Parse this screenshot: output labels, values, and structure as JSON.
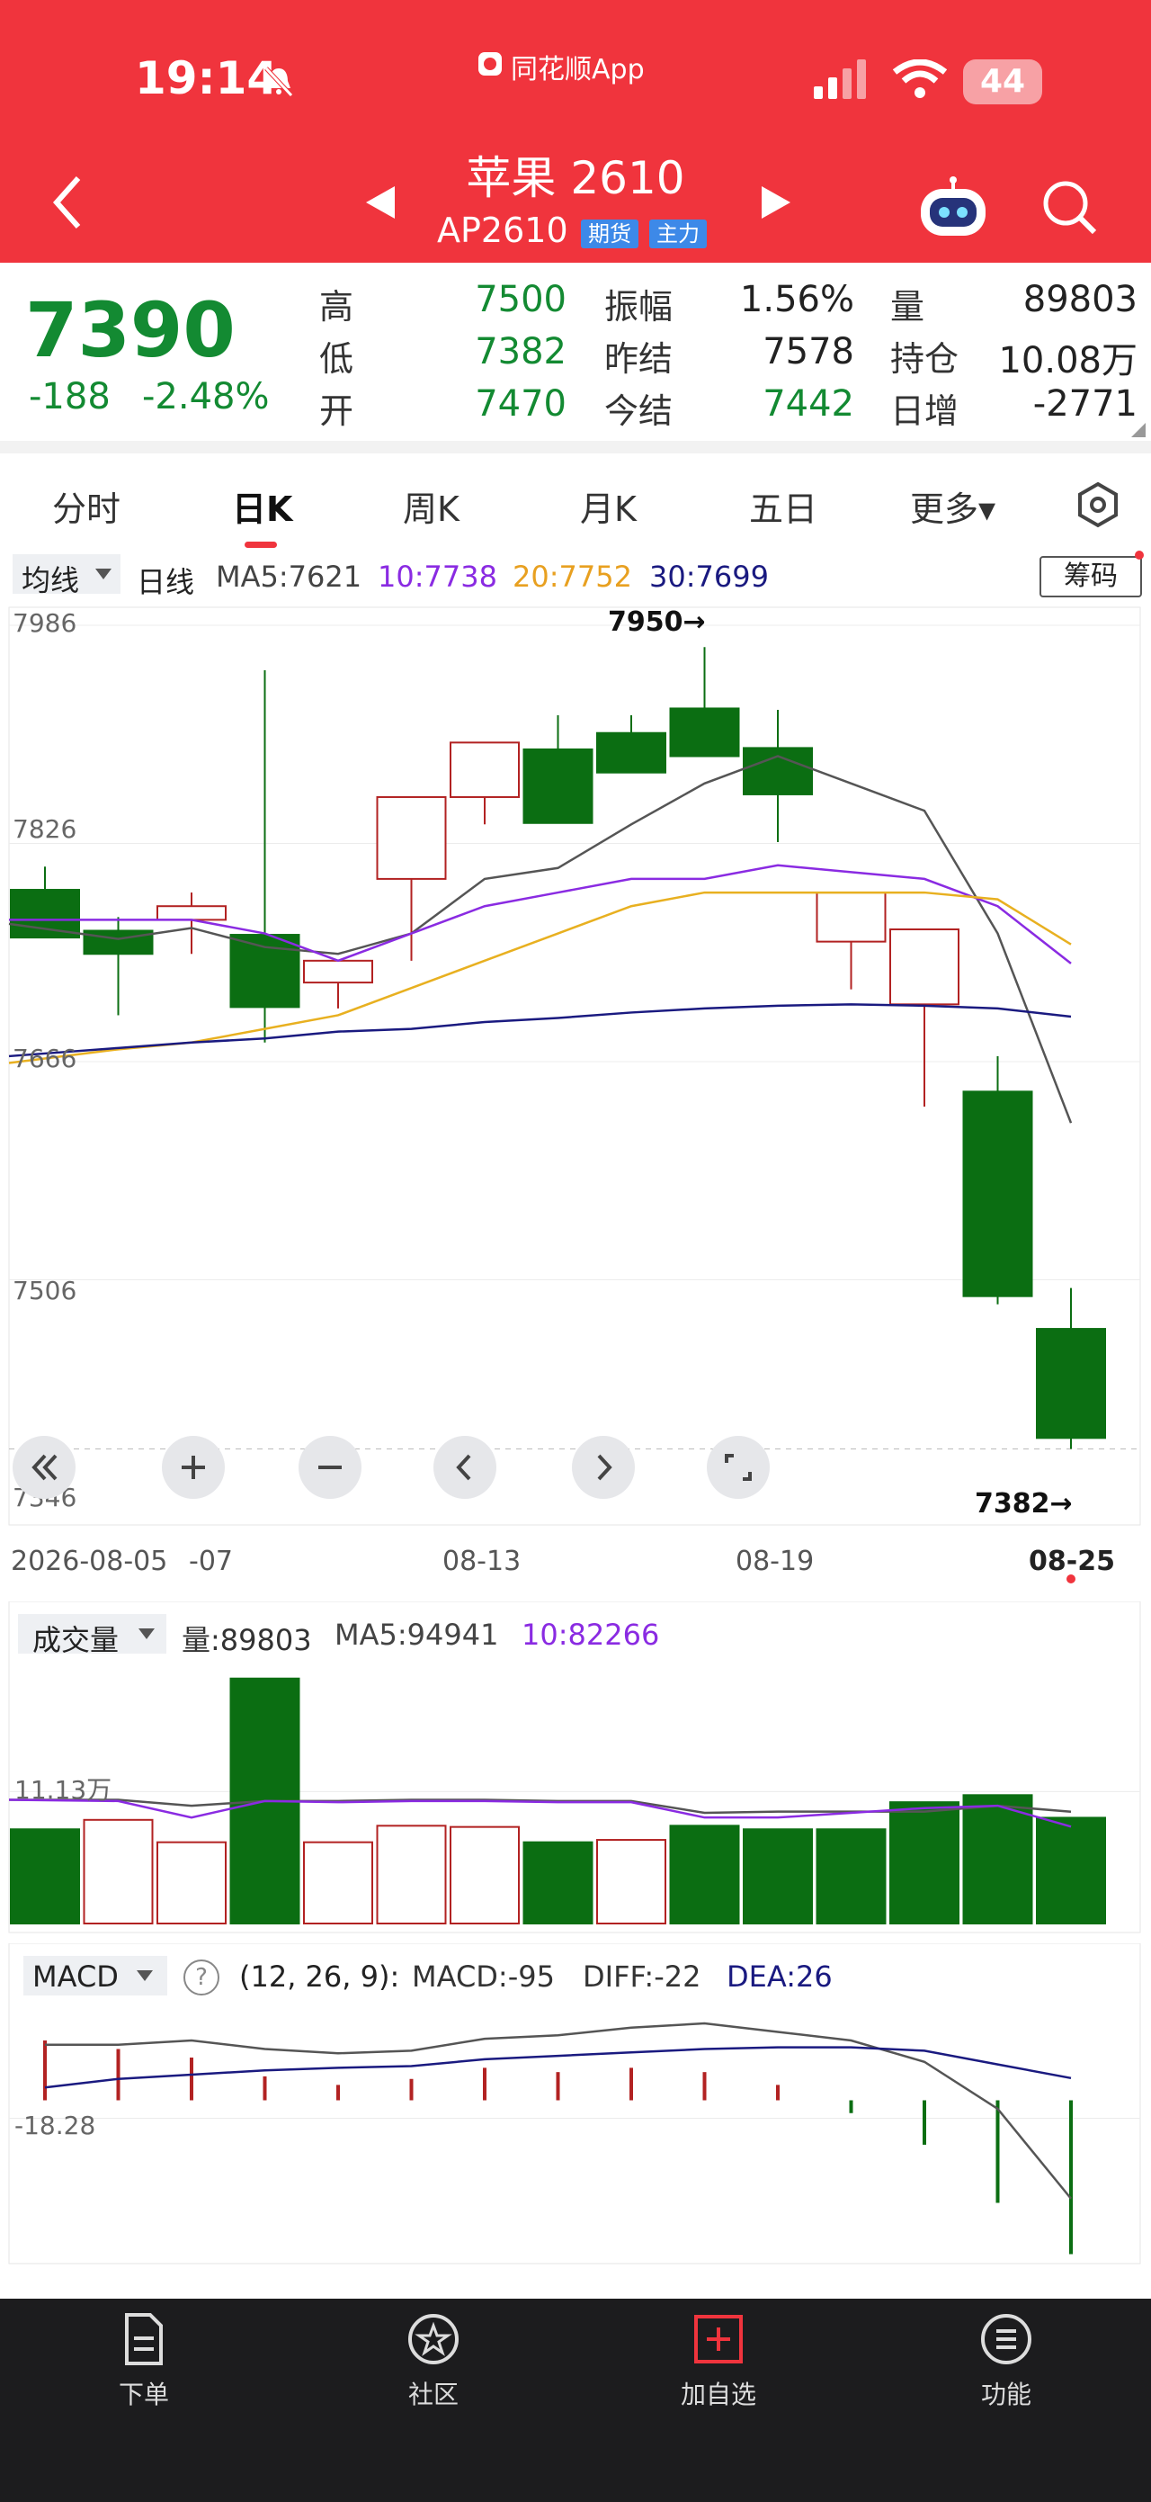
{
  "status_bar": {
    "time": "19:14",
    "app_label": "同花顺App",
    "battery": "44"
  },
  "header": {
    "title": "苹果 2610",
    "code": "AP2610",
    "tags": [
      "期货",
      "主力"
    ]
  },
  "quote": {
    "price": "7390",
    "change": "-188",
    "change_pct": "-2.48%",
    "fields": [
      {
        "label": "高",
        "value": "7500"
      },
      {
        "label": "低",
        "value": "7382"
      },
      {
        "label": "开",
        "value": "7470"
      },
      {
        "label": "振幅",
        "value": "1.56%"
      },
      {
        "label": "昨结",
        "value": "7578"
      },
      {
        "label": "今结",
        "value": "7442"
      },
      {
        "label": "量",
        "value": "89803"
      },
      {
        "label": "持仓",
        "value": "10.08万"
      },
      {
        "label": "日增",
        "value": "-2771"
      }
    ]
  },
  "tabs": [
    "分时",
    "日K",
    "周K",
    "月K",
    "五日",
    "更多▾"
  ],
  "ma_bar": {
    "selector": "均线",
    "period": "日线",
    "ma5": "MA5:7621",
    "ma10": "10:7738",
    "ma20": "20:7752",
    "ma30": "30:7699",
    "chip_button": "筹码"
  },
  "price_axis": [
    "7986",
    "7826",
    "7666",
    "7506",
    "7346"
  ],
  "annotations": {
    "high_mark": "7950→",
    "low_mark": "7382→"
  },
  "dates": [
    "2026-08-05",
    "-07",
    "08-13",
    "08-19",
    "08-25"
  ],
  "volume_bar": {
    "selector": "成交量",
    "vol": "量:89803",
    "ma5": "MA5:94941",
    "ma10": "10:82266",
    "axis": "11.13万"
  },
  "macd_bar": {
    "selector": "MACD",
    "help": "?",
    "params": "(12, 26, 9):",
    "macd": "MACD:-95",
    "diff": "DIFF:-22",
    "dea": "DEA:26",
    "axis": "-18.28"
  },
  "bottom_nav": [
    "下单",
    "社区",
    "加自选",
    "功能"
  ],
  "colors": {
    "header": "#f0343d",
    "up": "#b22222",
    "down": "#0b6e12",
    "ma5": "#555555",
    "ma10": "#8a2be2",
    "ma20": "#e8b020",
    "ma30": "#1a1a80"
  },
  "chart_data": [
    {
      "type": "candlestick",
      "title": "苹果 2610 日K",
      "x": [
        "2026-08-05",
        "08-06",
        "08-07",
        "08-08",
        "08-11",
        "08-12",
        "08-13",
        "08-14",
        "08-15",
        "08-18",
        "08-19",
        "08-20",
        "08-21",
        "08-22",
        "08-25"
      ],
      "ohlc": [
        [
          7792,
          7809,
          7760,
          7757
        ],
        [
          7762,
          7772,
          7700,
          7745
        ],
        [
          7770,
          7790,
          7745,
          7780
        ],
        [
          7759,
          7953,
          7680,
          7706
        ],
        [
          7724,
          7740,
          7705,
          7740
        ],
        [
          7800,
          7825,
          7740,
          7860
        ],
        [
          7860,
          7890,
          7840,
          7900
        ],
        [
          7895,
          7920,
          7845,
          7841
        ],
        [
          7907,
          7920,
          7888,
          7878
        ],
        [
          7925,
          7970,
          7896,
          7890
        ],
        [
          7896,
          7924,
          7827,
          7862
        ],
        [
          7754,
          7785,
          7719,
          7790
        ],
        [
          7708,
          7730,
          7633,
          7763
        ],
        [
          7644,
          7670,
          7488,
          7494
        ],
        [
          7470,
          7500,
          7382,
          7390
        ]
      ],
      "ylim": [
        7346,
        7986
      ],
      "ma5": [
        7767,
        7756,
        7764,
        7750,
        7745,
        7760,
        7800,
        7808,
        7840,
        7870,
        7890,
        7870,
        7850,
        7760,
        7621
      ],
      "ma10": [
        7770,
        7770,
        7770,
        7760,
        7740,
        7760,
        7780,
        7790,
        7800,
        7800,
        7810,
        7805,
        7800,
        7780,
        7738
      ],
      "ma20": [
        7665,
        7675,
        7680,
        7690,
        7700,
        7720,
        7740,
        7760,
        7780,
        7790,
        7790,
        7790,
        7790,
        7785,
        7752
      ],
      "ma30": [
        7670,
        7676,
        7680,
        7683,
        7688,
        7690,
        7695,
        7698,
        7702,
        7705,
        7707,
        7708,
        7707,
        7705,
        7699
      ]
    },
    {
      "type": "bar",
      "title": "成交量",
      "categories": [
        "2026-08-05",
        "08-06",
        "08-07",
        "08-08",
        "08-11",
        "08-12",
        "08-13",
        "08-14",
        "08-15",
        "08-18",
        "08-19",
        "08-20",
        "08-21",
        "08-22",
        "08-25"
      ],
      "values": [
        80000,
        88000,
        69000,
        208000,
        69000,
        83000,
        82000,
        69000,
        71000,
        83000,
        80000,
        80000,
        103000,
        109000,
        89803
      ],
      "up": [
        false,
        true,
        true,
        false,
        true,
        true,
        true,
        false,
        true,
        false,
        false,
        false,
        false,
        false,
        false
      ],
      "ma5": [
        105000,
        105000,
        100000,
        104000,
        104000,
        105000,
        105000,
        104000,
        104000,
        94000,
        95000,
        95000,
        95000,
        100000,
        94941
      ],
      "ma10": [
        105000,
        104000,
        90000,
        104000,
        103000,
        104000,
        104000,
        103000,
        103000,
        90000,
        90000,
        94000,
        98000,
        100000,
        82266
      ],
      "ylim": [
        0,
        220000
      ]
    },
    {
      "type": "bar",
      "title": "MACD",
      "categories": [
        "2026-08-05",
        "08-06",
        "08-07",
        "08-08",
        "08-11",
        "08-12",
        "08-13",
        "08-14",
        "08-15",
        "08-18",
        "08-19",
        "08-20",
        "08-21",
        "08-22",
        "08-25"
      ],
      "values": [
        70,
        60,
        50,
        28,
        18,
        25,
        38,
        33,
        38,
        33,
        18,
        -15,
        -52,
        -120,
        -180
      ],
      "diff": [
        65,
        65,
        70,
        60,
        55,
        58,
        72,
        76,
        85,
        90,
        80,
        70,
        45,
        -10,
        -115
      ],
      "dea": [
        15,
        25,
        30,
        35,
        38,
        40,
        48,
        52,
        56,
        60,
        62,
        62,
        58,
        42,
        26
      ],
      "ylim": [
        -190,
        110
      ]
    }
  ]
}
